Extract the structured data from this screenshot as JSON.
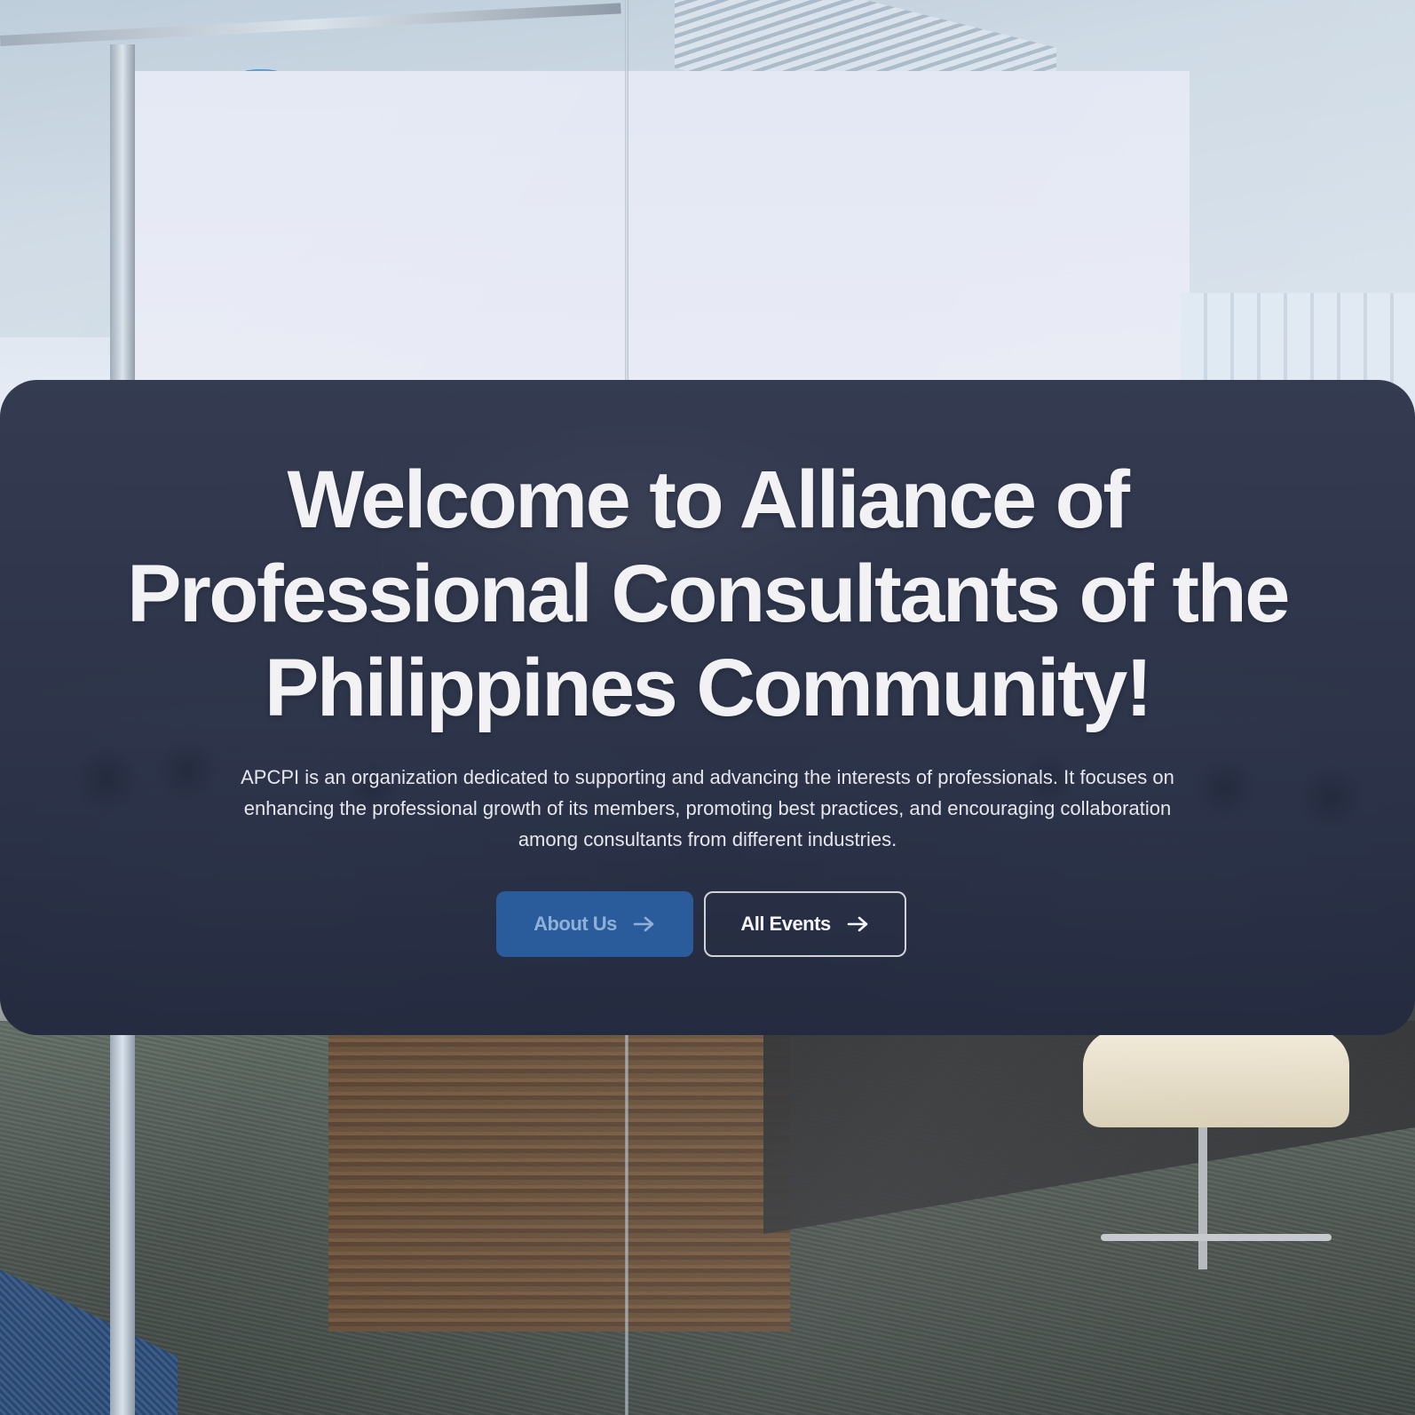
{
  "hero": {
    "title_line1": "Welcome to Alliance of",
    "title_line2": "Professional Consultants of the",
    "title_line3": "Philippines Community!",
    "description_line1": "APCPI is an organization dedicated to supporting and advancing the interests of professionals. It focuses on",
    "description_line2": "enhancing the professional growth of its members, promoting best practices, and encouraging collaboration",
    "description_line3": "among consultants from different industries.",
    "primary_button_label": "About Us",
    "secondary_button_label": "All Events",
    "arrow_icon": "arrow-right-icon"
  },
  "colors": {
    "primary_button_bg": "#2a5c9c",
    "primary_button_text": "#8fb0d8",
    "overlay": "#202840",
    "title_text": "#f2f2f4"
  }
}
